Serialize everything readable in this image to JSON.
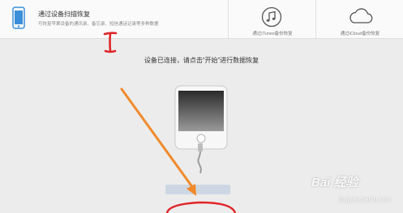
{
  "header": {
    "tabs": [
      {
        "id": "scan",
        "icon": "phone-icon",
        "title": "通过设备扫描恢复",
        "desc": "可恢复苹果设备的通讯录、备忘录、短信通话记录等多种数据",
        "active": true
      },
      {
        "id": "itunes",
        "icon": "music-note-icon",
        "label": "通过iTunes备份恢复",
        "active": false
      },
      {
        "id": "icloud",
        "icon": "cloud-icon",
        "label": "通过iCloud备份恢复",
        "active": false
      }
    ]
  },
  "annotation": {
    "number": "I",
    "color": "#e0262a"
  },
  "main": {
    "status_message": "设备已连接，请点击“开始”进行数据恢复"
  },
  "watermark": {
    "text": "Bai 经验",
    "sub": "jingyan.baidu.com"
  },
  "colors": {
    "accent_blue": "#3a8fd9",
    "arrow_orange": "#f08a2c",
    "annotation_red": "#e0262a"
  }
}
